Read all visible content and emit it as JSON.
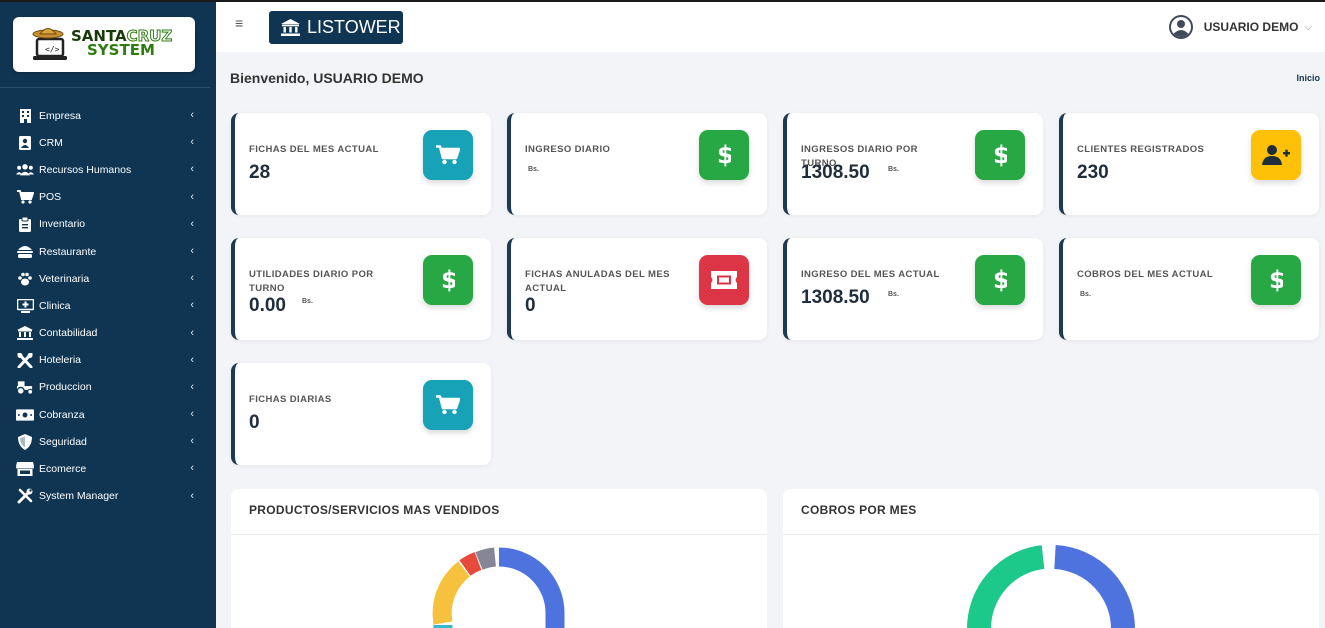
{
  "sidebar": {
    "logo_line1a": "SANTA",
    "logo_line1b": "CRUZ",
    "logo_line2": "SYSTEM",
    "items": [
      {
        "label": "Empresa",
        "icon": "building-icon"
      },
      {
        "label": "CRM",
        "icon": "contact-card-icon"
      },
      {
        "label": "Recursos Humanos",
        "icon": "users-icon"
      },
      {
        "label": "POS",
        "icon": "cart-icon"
      },
      {
        "label": "Inventario",
        "icon": "clipboard-icon"
      },
      {
        "label": "Restaurante",
        "icon": "burger-icon"
      },
      {
        "label": "Veterinaria",
        "icon": "paw-icon"
      },
      {
        "label": "Clinica",
        "icon": "medical-monitor-icon"
      },
      {
        "label": "Contabilidad",
        "icon": "bank-icon"
      },
      {
        "label": "Hoteleria",
        "icon": "utensils-cross-icon"
      },
      {
        "label": "Produccion",
        "icon": "tractor-icon"
      },
      {
        "label": "Cobranza",
        "icon": "money-bill-icon"
      },
      {
        "label": "Seguridad",
        "icon": "shield-icon"
      },
      {
        "label": "Ecomerce",
        "icon": "store-icon"
      },
      {
        "label": "System Manager",
        "icon": "tools-icon"
      }
    ],
    "chevron": "‹"
  },
  "topbar": {
    "menu_glyph": "≡",
    "brand_label": "LISTOWER",
    "user_name": "USUARIO DEMO",
    "user_chevron": "⌵"
  },
  "page": {
    "welcome": "Bienvenido, USUARIO DEMO",
    "breadcrumb": "Inicio"
  },
  "cards": [
    {
      "title": "FICHAS DEL MES ACTUAL",
      "value": "28",
      "unit": "",
      "icon": "cart-icon",
      "color": "#17a2b8"
    },
    {
      "title": "INGRESO DIARIO",
      "value": "",
      "unit": "Bs.",
      "icon": "dollar-icon",
      "color": "#28a745"
    },
    {
      "title": "INGRESOS DIARIO POR TURNO",
      "value": "1308.50",
      "unit": "Bs.",
      "icon": "dollar-icon",
      "color": "#28a745"
    },
    {
      "title": "CLIENTES REGISTRADOS",
      "value": "230",
      "unit": "",
      "icon": "user-plus-icon",
      "color": "#ffc107"
    },
    {
      "title": "UTILIDADES DIARIO POR TURNO",
      "value": "0.00",
      "unit": "Bs.",
      "icon": "dollar-icon",
      "color": "#28a745"
    },
    {
      "title": "FICHAS ANULADAS DEL MES ACTUAL",
      "value": "0",
      "unit": "",
      "icon": "ticket-icon",
      "color": "#dc3545"
    },
    {
      "title": "INGRESO DEL MES ACTUAL",
      "value": "1308.50",
      "unit": "Bs.",
      "icon": "dollar-icon",
      "color": "#28a745"
    },
    {
      "title": "COBROS DEL MES ACTUAL",
      "value": "",
      "unit": "Bs.",
      "icon": "dollar-icon",
      "color": "#28a745"
    },
    {
      "title": "FICHAS DIARIAS",
      "value": "0",
      "unit": "",
      "icon": "cart-icon",
      "color": "#17a2b8"
    }
  ],
  "panels": {
    "products_title": "PRODUCTOS/SERVICIOS MAS VENDIDOS",
    "cobros_title": "COBROS POR MES"
  },
  "colors": {
    "sidebar_bg": "#0f3553",
    "brand_bg": "#0f3553",
    "donut_blue": "#4e73df",
    "donut_yellow": "#f6c23e",
    "donut_red": "#e74a3b",
    "donut_gray": "#858796",
    "donut_teal": "#36b9cc",
    "donut_green": "#1cc88a"
  }
}
